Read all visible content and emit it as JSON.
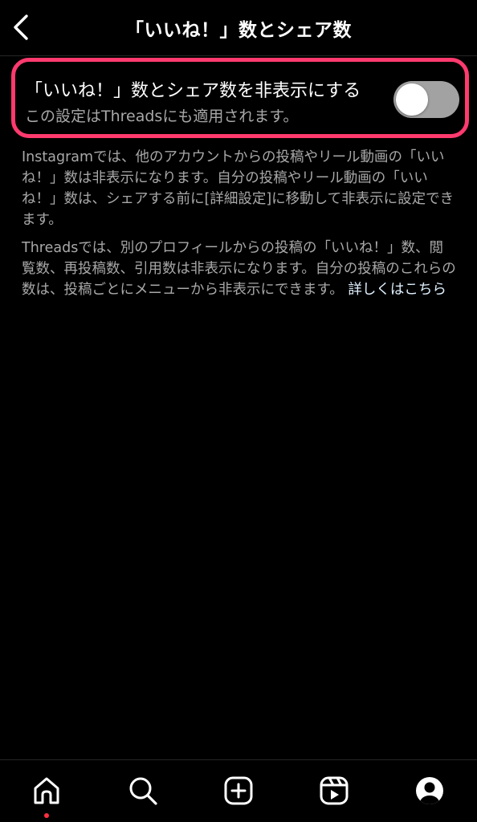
{
  "header": {
    "title": "「いいね！」数とシェア数",
    "back_icon": "chevron-left-icon"
  },
  "setting": {
    "label": "「いいね！」数とシェア数を非表示にする",
    "sublabel": "この設定はThreadsにも適用されます。",
    "toggle_on": false,
    "highlight_color": "#ff3a6e"
  },
  "description": {
    "p1": "Instagramでは、他のアカウントからの投稿やリール動画の「いいね！」数は非表示になります。自分の投稿やリール動画の「いいね！」数は、シェアする前に[詳細設定]に移動して非表示に設定できます。",
    "p2": "Threadsでは、別のプロフィールからの投稿の「いいね！」数、閲覧数、再投稿数、引用数は非表示になります。自分の投稿のこれらの数は、投稿ごとにメニューから非表示にできます。",
    "learn_more": "詳しくはこちら"
  },
  "bottom_nav": {
    "items": [
      "home-icon",
      "search-icon",
      "create-icon",
      "reels-icon",
      "profile-icon"
    ],
    "active": "home-icon",
    "notification_dot_color": "#ff3040"
  }
}
